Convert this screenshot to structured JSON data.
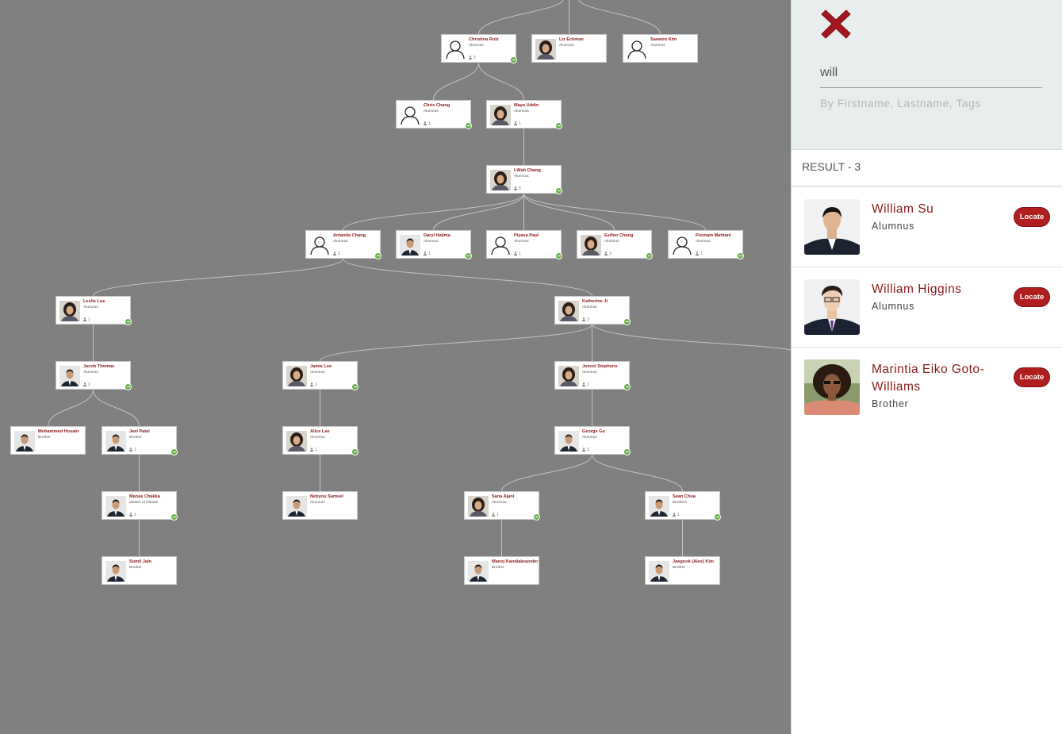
{
  "tree": {
    "nodes": [
      {
        "id": "christina",
        "name": "Christina Ruiz",
        "role": "Alumnus",
        "count": "2",
        "photo": "default"
      },
      {
        "id": "liz",
        "name": "Liz Eckman",
        "role": "Alumnus",
        "count": "",
        "photo": "woman"
      },
      {
        "id": "saewon",
        "name": "Saewon Kim",
        "role": "Alumnus",
        "count": "",
        "photo": "default"
      },
      {
        "id": "chris",
        "name": "Chris Chang",
        "role": "Alumnus",
        "count": "1",
        "photo": "default"
      },
      {
        "id": "maya",
        "name": "Maya Uddin",
        "role": "Alumnus",
        "count": "1",
        "photo": "woman"
      },
      {
        "id": "iwah",
        "name": "I-Wah Chang",
        "role": "Alumnus",
        "count": "5",
        "photo": "woman"
      },
      {
        "id": "amanda",
        "name": "Amanda Chang",
        "role": "Alumnus",
        "count": "2",
        "photo": "default"
      },
      {
        "id": "daryl",
        "name": "Daryl Halima",
        "role": "Alumnus",
        "count": "1",
        "photo": "man"
      },
      {
        "id": "piyasa",
        "name": "Piyasa Paul",
        "role": "Alumnus",
        "count": "1",
        "photo": "default"
      },
      {
        "id": "esther",
        "name": "Esther Chang",
        "role": "Alumnus",
        "count": "3",
        "photo": "woman"
      },
      {
        "id": "poonam",
        "name": "Poonam Mahtani",
        "role": "Alumnus",
        "count": "1",
        "photo": "default"
      },
      {
        "id": "leslie",
        "name": "Leslie Lue",
        "role": "Alumnus",
        "count": "1",
        "photo": "woman"
      },
      {
        "id": "katherine",
        "name": "Katherine Ji",
        "role": "Alumnus",
        "count": "3",
        "photo": "woman"
      },
      {
        "id": "jacob",
        "name": "Jacob Thomas",
        "role": "Alumnus",
        "count": "2",
        "photo": "man"
      },
      {
        "id": "jamie",
        "name": "Jamie Lee",
        "role": "Alumnus",
        "count": "1",
        "photo": "woman"
      },
      {
        "id": "joncel",
        "name": "Joncel Stephens",
        "role": "Alumnus",
        "count": "1",
        "photo": "woman"
      },
      {
        "id": "mohammed",
        "name": "Mohammed Husain",
        "role": "Brother",
        "count": "",
        "photo": "man"
      },
      {
        "id": "jeel",
        "name": "Jeel Patel",
        "role": "Brother",
        "count": "1",
        "photo": "man"
      },
      {
        "id": "alice",
        "name": "Alice Lee",
        "role": "Alumnus",
        "count": "1",
        "photo": "woman"
      },
      {
        "id": "george",
        "name": "George Gu",
        "role": "Alumnus",
        "count": "2",
        "photo": "man"
      },
      {
        "id": "manas",
        "name": "Manas Chakka",
        "role": "Master of Rituals",
        "count": "1",
        "photo": "man"
      },
      {
        "id": "nebyou",
        "name": "Nebyou Samuel",
        "role": "Alumnus",
        "count": "",
        "photo": "man"
      },
      {
        "id": "sana",
        "name": "Sana Ajani",
        "role": "Alumnus",
        "count": "1",
        "photo": "woman"
      },
      {
        "id": "sean",
        "name": "Sean Chua",
        "role": "Brothers",
        "count": "1",
        "photo": "man"
      },
      {
        "id": "somil",
        "name": "Somil Jain",
        "role": "Brother",
        "count": "",
        "photo": "man"
      },
      {
        "id": "manoj",
        "name": "Manoj Kandiakounder",
        "role": "Brother",
        "count": "",
        "photo": "man"
      },
      {
        "id": "jaegook",
        "name": "Jaegook (Alex) Kim",
        "role": "Brother",
        "count": "",
        "photo": "man"
      }
    ]
  },
  "panel": {
    "search_value": "will",
    "search_hint": "By Firstname, Lastname, Tags",
    "result_count": "RESULT - 3",
    "results": [
      {
        "name": "William Su",
        "role": "Alumnus",
        "locate_label": "Locate"
      },
      {
        "name": "William Higgins",
        "role": "Alumnus",
        "locate_label": "Locate"
      },
      {
        "name": "Marintia Eiko Goto-Williams",
        "role": "Brother",
        "locate_label": "Locate"
      }
    ]
  },
  "colors": {
    "accent": "#8b1a1a",
    "close": "#a31820",
    "toggle": "#6ab04c",
    "canvas": "#808080"
  }
}
